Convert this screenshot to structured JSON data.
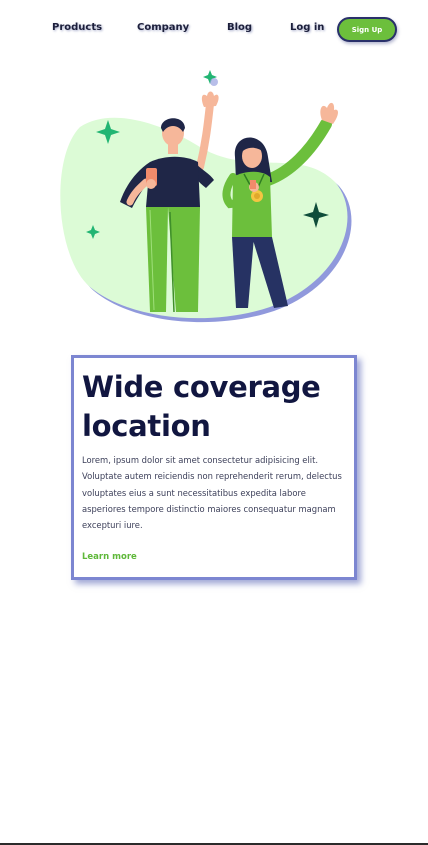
{
  "nav": {
    "items": [
      "Products",
      "Company",
      "Blog",
      "Log in"
    ],
    "signup_label": "Sign Up"
  },
  "colors": {
    "accent_green": "#6cbf3c",
    "navy": "#111640",
    "card_border": "#7c86d1",
    "blob": "#dcfbd6"
  },
  "hero": {
    "illustration": "two-people-waving-illustration"
  },
  "card": {
    "title_line1": "Wide coverage",
    "title_line2": "location",
    "body": "Lorem, ipsum dolor sit amet consectetur adipisicing elit. Voluptate autem reiciendis non reprehenderit rerum, delectus voluptates eius a sunt necessitatibus expedita labore asperiores tempore distinctio maiores consequatur magnam excepturi iure.",
    "link_label": "Learn more"
  }
}
